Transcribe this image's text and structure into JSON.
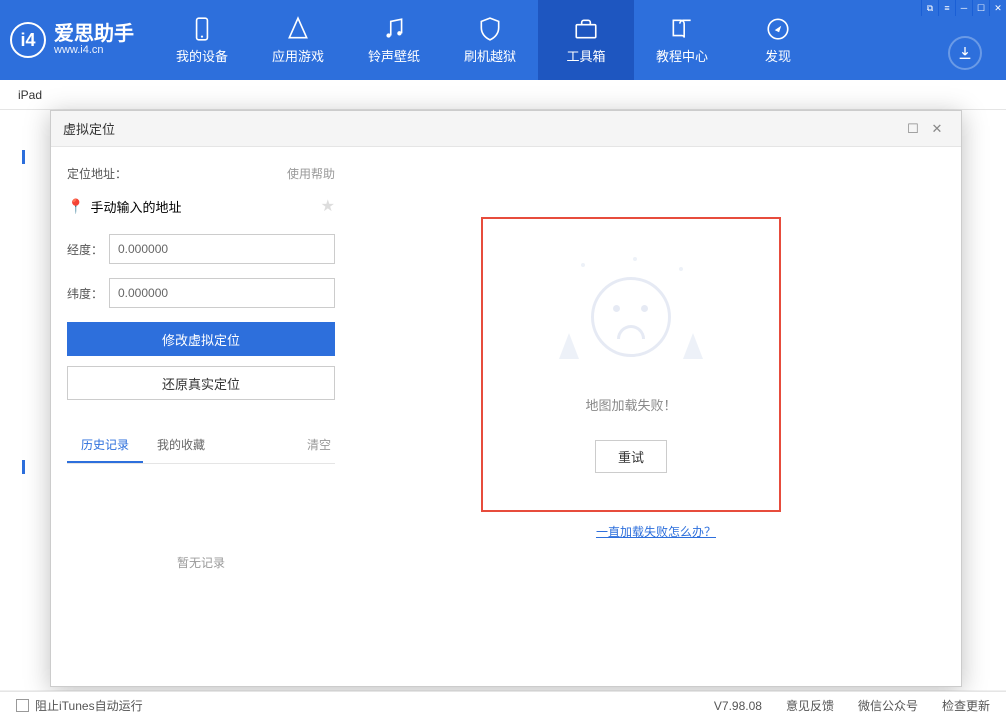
{
  "app": {
    "name": "爱思助手",
    "url": "www.i4.cn"
  },
  "nav": {
    "items": [
      {
        "label": "我的设备"
      },
      {
        "label": "应用游戏"
      },
      {
        "label": "铃声壁纸"
      },
      {
        "label": "刷机越狱"
      },
      {
        "label": "工具箱"
      },
      {
        "label": "教程中心"
      },
      {
        "label": "发现"
      }
    ]
  },
  "subbar": {
    "device": "iPad"
  },
  "modal": {
    "title": "虚拟定位",
    "addr_label": "定位地址：",
    "help": "使用帮助",
    "manual_addr": "手动输入的地址",
    "lng_label": "经度：",
    "lat_label": "纬度：",
    "lng_value": "0.000000",
    "lat_value": "0.000000",
    "btn_modify": "修改虚拟定位",
    "btn_restore": "还原真实定位",
    "tabs": {
      "history": "历史记录",
      "favorites": "我的收藏",
      "clear": "清空"
    },
    "empty": "暂无记录",
    "map_fail": "地图加载失败！",
    "retry": "重试",
    "fail_help": "一直加载失败怎么办？"
  },
  "footer": {
    "block_itunes": "阻止iTunes自动运行",
    "version": "V7.98.08",
    "feedback": "意见反馈",
    "wechat": "微信公众号",
    "update": "检查更新"
  }
}
